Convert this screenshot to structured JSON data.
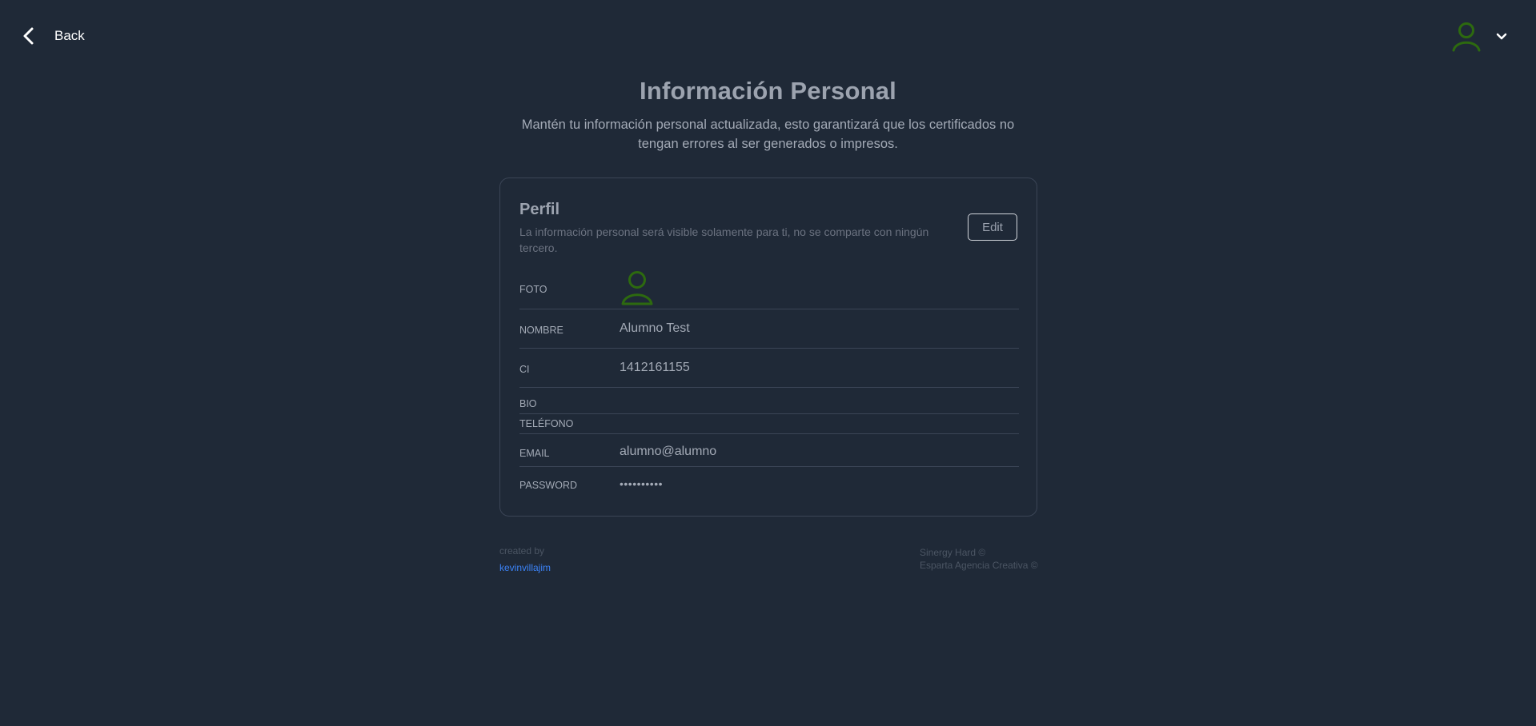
{
  "header": {
    "back_label": "Back"
  },
  "hero": {
    "title": "Información Personal",
    "subtitle": "Mantén tu información personal actualizada, esto garantizará que los certificados no tengan errores al ser generados o impresos."
  },
  "profile": {
    "title": "Perfil",
    "description": "La información personal será visible solamente para ti, no se comparte con ningún tercero.",
    "edit_label": "Edit",
    "fields": {
      "foto_label": "FOTO",
      "nombre_label": "NOMBRE",
      "nombre_value": "Alumno Test",
      "ci_label": "CI",
      "ci_value": "1412161155",
      "bio_label": "BIO",
      "bio_value": "",
      "telefono_label": "TELÉFONO",
      "telefono_value": "",
      "email_label": "EMAIL",
      "email_value": "alumno@alumno",
      "password_label": "PASSWORD",
      "password_value": "••••••••••"
    }
  },
  "footer": {
    "created_by": "created by",
    "author": "kevinvillajim",
    "credit_1": "Sinergy Hard ©",
    "credit_2": "Esparta Agencia Creativa ©"
  },
  "colors": {
    "background": "#1f2937",
    "avatar_green": "#2d6a0f",
    "link_blue": "#3b82f6",
    "border": "#3b4556"
  },
  "icons": {
    "back": "chevron-left-icon",
    "avatar": "user-icon",
    "menu": "chevron-down-icon"
  }
}
